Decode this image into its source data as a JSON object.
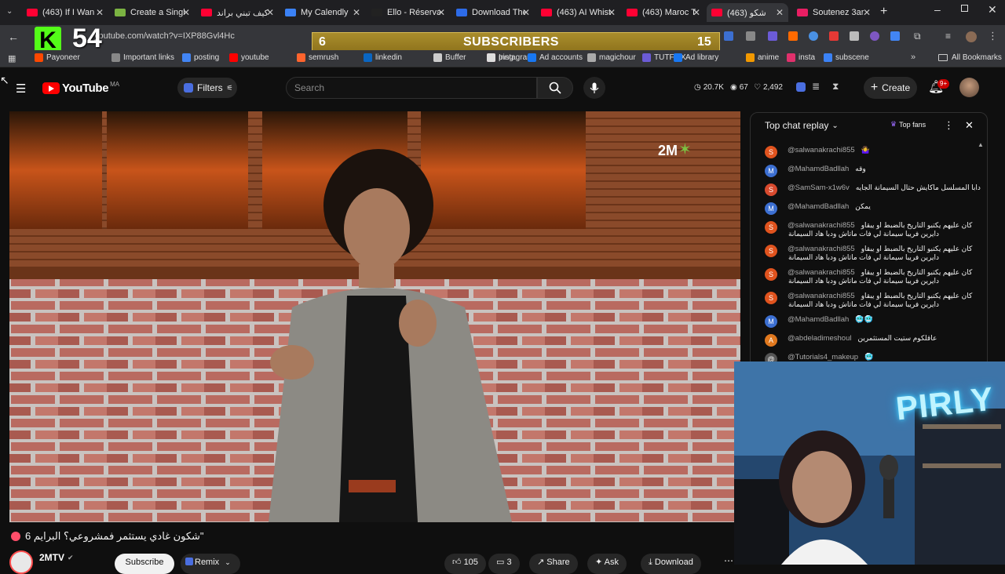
{
  "browser": {
    "tabs": [
      {
        "label": "(463) If I Wan",
        "color": "#ff0033"
      },
      {
        "label": "Create a Singl",
        "color": "#7bb342"
      },
      {
        "label": "كيف تبني براند",
        "color": "#ff0033"
      },
      {
        "label": "My Calendly",
        "color": "#3b82f6"
      },
      {
        "label": "Ello - Réservat",
        "color": "#222222"
      },
      {
        "label": "Download The",
        "color": "#2d6be8"
      },
      {
        "label": "(463) AI Whist",
        "color": "#ff0033"
      },
      {
        "label": "(463) Maroc T",
        "color": "#ff0033"
      },
      {
        "label": "(463) شكو",
        "color": "#ff0033"
      },
      {
        "label": "Soutenez 3ar",
        "color": "#e91e63"
      }
    ],
    "url": "youtube.com/watch?v=IXP88Gvl4Hc",
    "bookmarks": [
      {
        "label": "Payoneer",
        "color": "#ff4800"
      },
      {
        "label": "Important links",
        "color": "#888888"
      },
      {
        "label": "posting",
        "color": "#4285f4"
      },
      {
        "label": "youtube",
        "color": "#ff0000"
      },
      {
        "label": "semrush",
        "color": "#ff642d"
      },
      {
        "label": "linkedin",
        "color": "#0a66c2"
      },
      {
        "label": "Buffer",
        "color": "#cccccc"
      },
      {
        "label": "Instagram",
        "color": "#e1306c"
      },
      {
        "label": "ping",
        "color": "#dddddd"
      },
      {
        "label": "Ad accounts",
        "color": "#1877f2"
      },
      {
        "label": "magichour",
        "color": "#aaaaaa"
      },
      {
        "label": "TUTFLIX",
        "color": "#6b5bd6"
      },
      {
        "label": "Ad library",
        "color": "#1877f2"
      },
      {
        "label": "anime",
        "color": "#f29900"
      },
      {
        "label": "insta",
        "color": "#e1306c"
      },
      {
        "label": "subscene",
        "color": "#3b82f6"
      }
    ],
    "all_bookmarks": "All Bookmarks"
  },
  "overlay": {
    "kick_logo": "K",
    "kick_count": "54",
    "subs_left": "6",
    "subs_label": "SUBSCRIBERS",
    "subs_right": "15"
  },
  "youtube": {
    "logo": "YouTube",
    "country": "MA",
    "filters": "Filters",
    "search_placeholder": "Search",
    "stats": {
      "views": "20.7K",
      "eye": "67",
      "count": "2,492"
    },
    "create": "Create",
    "notif_badge": "9+"
  },
  "video": {
    "title": "شكون غادي يستثمر فمشروعي؟ البرايم 6\"",
    "watermark": "2M",
    "channel": "2MTV",
    "subscribe": "Subscribe",
    "remix": "Remix",
    "actions": {
      "likes": "105",
      "comments": "3",
      "share": "Share",
      "ask": "Ask",
      "download": "Download"
    }
  },
  "chat": {
    "title": "Top chat replay",
    "top_fans": "Top fans",
    "messages": [
      {
        "initial": "S",
        "color": "#e0531e",
        "name": "@salwanakrachi855",
        "text": "🤷‍♀️",
        "text2": ""
      },
      {
        "initial": "M",
        "color": "#3c6fd1",
        "name": "@MahamdBadllah",
        "text": "وقه",
        "text2": ""
      },
      {
        "initial": "S",
        "color": "#d84a2e",
        "name": "@SamSam-x1w6v",
        "text": "دابا المسلسل ماكايش حتال السيمانة الجايه",
        "text2": ""
      },
      {
        "initial": "M",
        "color": "#3c6fd1",
        "name": "@MahamdBadllah",
        "text": "يمكن",
        "text2": ""
      },
      {
        "initial": "S",
        "color": "#e0531e",
        "name": "@salwanakrachi855",
        "text": "كان عليهم يكتبو التاريخ بالضبط او يبقاو",
        "text2": "دايرين فريبا سيمانة لي فات ماتاش ودبا هاد السيمانة"
      },
      {
        "initial": "S",
        "color": "#e0531e",
        "name": "@salwanakrachi855",
        "text": "كان عليهم يكتبو التاريخ بالضبط او يبقاو",
        "text2": "دايرين فريبا سيمانة لي فات ماتاش ودبا هاد السيمانة"
      },
      {
        "initial": "S",
        "color": "#e0531e",
        "name": "@salwanakrachi855",
        "text": "كان عليهم يكتبو التاريخ بالضبط او يبقاو",
        "text2": "دايرين فريبا سيمانة لي فات ماتاش ودبا هاد السيمانة"
      },
      {
        "initial": "S",
        "color": "#e0531e",
        "name": "@salwanakrachi855",
        "text": "كان عليهم يكتبو التاريخ بالضبط او يبقاو",
        "text2": "دايرين فريبا سيمانة لي فات ماتاش ودبا هاد السيمانة"
      },
      {
        "initial": "M",
        "color": "#3c6fd1",
        "name": "@MahamdBadllah",
        "text": "🥶🥶",
        "text2": ""
      },
      {
        "initial": "A",
        "color": "#e0781e",
        "name": "@abdeladimeshoul",
        "text": "عاقلكوم ستيت المستثمرين",
        "text2": ""
      },
      {
        "initial": "@",
        "color": "#555555",
        "name": "@Tutorials4_makeup",
        "text": "🥶",
        "text2": ""
      }
    ]
  },
  "webcam": {
    "neon_sign": "PIRLY"
  }
}
